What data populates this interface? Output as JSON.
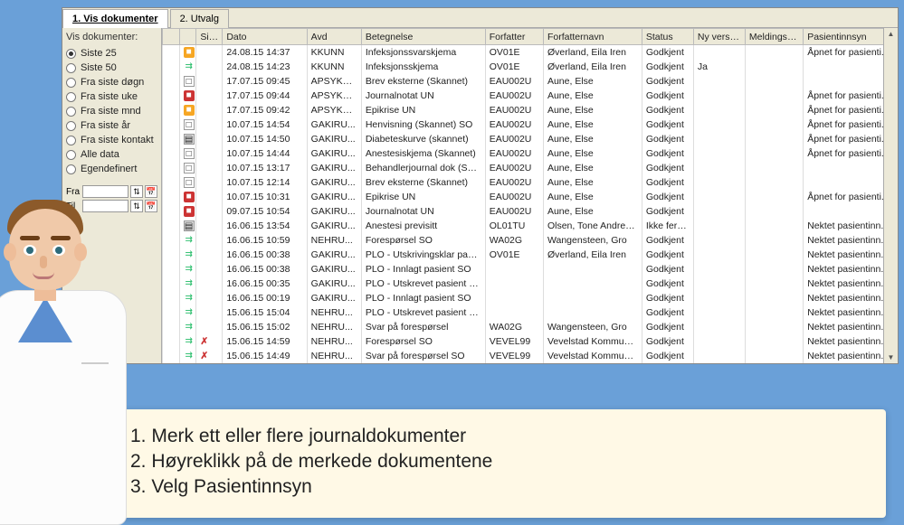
{
  "tabs": {
    "view_docs": "1. Vis dokumenter",
    "selection": "2. Utvalg"
  },
  "sidebar": {
    "group_label": "Vis dokumenter:",
    "options": [
      "Siste 25",
      "Siste 50",
      "Fra siste døgn",
      "Fra siste uke",
      "Fra siste mnd",
      "Fra siste år",
      "Fra siste kontakt",
      "Alle data",
      "Egendefinert"
    ],
    "selected_index": 0,
    "from_label": "Fra",
    "to_label": "Til"
  },
  "grid": {
    "headers": [
      "",
      "",
      "Sign",
      "Dato",
      "Avd",
      "Betegnelse",
      "Forfatter",
      "Forfatternavn",
      "Status",
      "Ny versjon",
      "Meldingstype",
      "Pasientinnsyn"
    ],
    "rows": [
      {
        "icon": "orange",
        "sign": "",
        "dato": "24.08.15 14:37",
        "avd": "KKUNN",
        "bet": "Infeksjonssvarskjema",
        "forf": "OV01E",
        "fnavn": "Øverland, Eila Iren",
        "stat": "Godkjent",
        "nyv": "",
        "meld": "",
        "pinn": "Åpnet for pasienti..."
      },
      {
        "icon": "tree",
        "sign": "",
        "dato": "24.08.15 14:23",
        "avd": "KKUNN",
        "bet": "Infeksjonsskjema",
        "forf": "OV01E",
        "fnavn": "Øverland, Eila Iren",
        "stat": "Godkjent",
        "nyv": "Ja",
        "meld": "",
        "pinn": ""
      },
      {
        "icon": "page",
        "sign": "",
        "dato": "17.07.15 09:45",
        "avd": "APSYKU...",
        "bet": "Brev eksterne (Skannet)",
        "forf": "EAU002U",
        "fnavn": "Aune, Else",
        "stat": "Godkjent",
        "nyv": "",
        "meld": "",
        "pinn": ""
      },
      {
        "icon": "pdf",
        "sign": "",
        "dato": "17.07.15 09:44",
        "avd": "APSYKU...",
        "bet": "Journalnotat UN",
        "forf": "EAU002U",
        "fnavn": "Aune, Else",
        "stat": "Godkjent",
        "nyv": "",
        "meld": "",
        "pinn": "Åpnet for pasienti..."
      },
      {
        "icon": "orange",
        "sign": "",
        "dato": "17.07.15 09:42",
        "avd": "APSYKU...",
        "bet": "Epikrise UN",
        "forf": "EAU002U",
        "fnavn": "Aune, Else",
        "stat": "Godkjent",
        "nyv": "",
        "meld": "",
        "pinn": "Åpnet for pasienti..."
      },
      {
        "icon": "page",
        "sign": "",
        "dato": "10.07.15 14:54",
        "avd": "GAKIRU...",
        "bet": "Henvisning (Skannet) SO",
        "forf": "EAU002U",
        "fnavn": "Aune, Else",
        "stat": "Godkjent",
        "nyv": "",
        "meld": "",
        "pinn": "Åpnet for pasienti..."
      },
      {
        "icon": "report",
        "sign": "",
        "dato": "10.07.15 14:50",
        "avd": "GAKIRU...",
        "bet": "Diabeteskurve (skannet)",
        "forf": "EAU002U",
        "fnavn": "Aune, Else",
        "stat": "Godkjent",
        "nyv": "",
        "meld": "",
        "pinn": "Åpnet for pasienti..."
      },
      {
        "icon": "page",
        "sign": "",
        "dato": "10.07.15 14:44",
        "avd": "GAKIRU...",
        "bet": "Anestesiskjema (Skannet)",
        "forf": "EAU002U",
        "fnavn": "Aune, Else",
        "stat": "Godkjent",
        "nyv": "",
        "meld": "",
        "pinn": "Åpnet for pasienti..."
      },
      {
        "icon": "page",
        "sign": "",
        "dato": "10.07.15 13:17",
        "avd": "GAKIRU...",
        "bet": "Behandlerjournal dok (Ska...",
        "forf": "EAU002U",
        "fnavn": "Aune, Else",
        "stat": "Godkjent",
        "nyv": "",
        "meld": "",
        "pinn": ""
      },
      {
        "icon": "page",
        "sign": "",
        "dato": "10.07.15 12:14",
        "avd": "GAKIRU...",
        "bet": "Brev eksterne (Skannet)",
        "forf": "EAU002U",
        "fnavn": "Aune, Else",
        "stat": "Godkjent",
        "nyv": "",
        "meld": "",
        "pinn": ""
      },
      {
        "icon": "pdf",
        "sign": "",
        "dato": "10.07.15 10:31",
        "avd": "GAKIRU...",
        "bet": "Epikrise UN",
        "forf": "EAU002U",
        "fnavn": "Aune, Else",
        "stat": "Godkjent",
        "nyv": "",
        "meld": "",
        "pinn": "Åpnet for pasienti..."
      },
      {
        "icon": "pdf",
        "sign": "",
        "dato": "09.07.15 10:54",
        "avd": "GAKIRU...",
        "bet": "Journalnotat UN",
        "forf": "EAU002U",
        "fnavn": "Aune, Else",
        "stat": "Godkjent",
        "nyv": "",
        "meld": "",
        "pinn": ""
      },
      {
        "icon": "report",
        "sign": "",
        "dato": "16.06.15 13:54",
        "avd": "GAKIRU...",
        "bet": "Anestesi previsitt",
        "forf": "OL01TU",
        "fnavn": "Olsen, Tone Andreas...",
        "stat": "Ikke ferdig",
        "nyv": "",
        "meld": "",
        "pinn": "Nektet pasientinn..."
      },
      {
        "icon": "tree",
        "sign": "",
        "dato": "16.06.15 10:59",
        "avd": "NEHRU...",
        "bet": "Forespørsel SO",
        "forf": "WA02G",
        "fnavn": "Wangensteen, Gro",
        "stat": "Godkjent",
        "nyv": "",
        "meld": "",
        "pinn": "Nektet pasientinn..."
      },
      {
        "icon": "tree",
        "sign": "",
        "dato": "16.06.15 00:38",
        "avd": "GAKIRU...",
        "bet": "PLO - Utskrivingsklar pasi ...",
        "forf": "OV01E",
        "fnavn": "Øverland, Eila Iren",
        "stat": "Godkjent",
        "nyv": "",
        "meld": "",
        "pinn": "Nektet pasientinn..."
      },
      {
        "icon": "tree",
        "sign": "",
        "dato": "16.06.15 00:38",
        "avd": "GAKIRU...",
        "bet": "PLO - Innlagt pasient SO",
        "forf": "",
        "fnavn": "",
        "stat": "Godkjent",
        "nyv": "",
        "meld": "",
        "pinn": "Nektet pasientinn..."
      },
      {
        "icon": "tree",
        "sign": "",
        "dato": "16.06.15 00:35",
        "avd": "GAKIRU...",
        "bet": "PLO - Utskrevet pasient SO",
        "forf": "",
        "fnavn": "",
        "stat": "Godkjent",
        "nyv": "",
        "meld": "",
        "pinn": "Nektet pasientinn..."
      },
      {
        "icon": "tree",
        "sign": "",
        "dato": "16.06.15 00:19",
        "avd": "GAKIRU...",
        "bet": "PLO - Innlagt pasient SO",
        "forf": "",
        "fnavn": "",
        "stat": "Godkjent",
        "nyv": "",
        "meld": "",
        "pinn": "Nektet pasientinn..."
      },
      {
        "icon": "tree",
        "sign": "",
        "dato": "15.06.15 15:04",
        "avd": "NEHRU...",
        "bet": "PLO - Utskrevet pasient SO",
        "forf": "",
        "fnavn": "",
        "stat": "Godkjent",
        "nyv": "",
        "meld": "",
        "pinn": "Nektet pasientinn..."
      },
      {
        "icon": "tree",
        "sign": "",
        "dato": "15.06.15 15:02",
        "avd": "NEHRU...",
        "bet": "Svar på forespørsel",
        "forf": "WA02G",
        "fnavn": "Wangensteen, Gro",
        "stat": "Godkjent",
        "nyv": "",
        "meld": "",
        "pinn": "Nektet pasientinn..."
      },
      {
        "icon": "tree",
        "sign": "✗",
        "dato": "15.06.15 14:59",
        "avd": "NEHRU...",
        "bet": "Forespørsel SO",
        "forf": "VEVEL99",
        "fnavn": "Vevelstad Kommune ...",
        "stat": "Godkjent",
        "nyv": "",
        "meld": "",
        "pinn": "Nektet pasientinn..."
      },
      {
        "icon": "tree",
        "sign": "✗",
        "dato": "15.06.15 14:49",
        "avd": "NEHRU...",
        "bet": "Svar på forespørsel SO",
        "forf": "VEVEL99",
        "fnavn": "Vevelstad Kommune ...",
        "stat": "Godkjent",
        "nyv": "",
        "meld": "",
        "pinn": "Nektet pasientinn..."
      }
    ]
  },
  "instructions": {
    "step1": "1. Merk ett eller flere journaldokumenter",
    "step2": "2. Høyreklikk på de merkede dokumentene",
    "step3": "3. Velg Pasientinnsyn"
  }
}
